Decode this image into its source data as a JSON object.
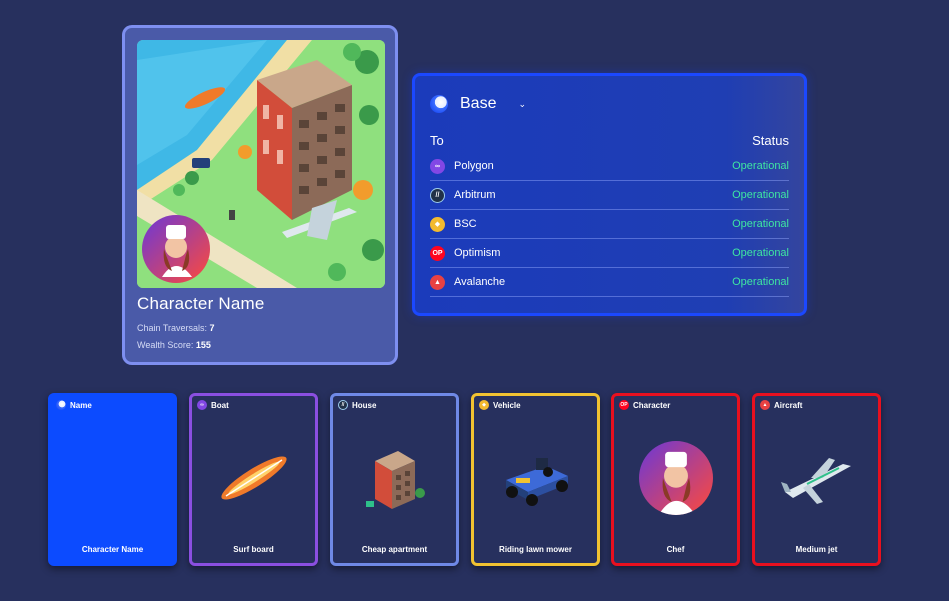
{
  "character": {
    "name": "Character Name",
    "traversals_label": "Chain Traversals:",
    "traversals_value": "7",
    "wealth_label": "Wealth Score:",
    "wealth_value": "155"
  },
  "bridge": {
    "selected_chain": "Base",
    "selected_icon": "base-icon",
    "col_to": "To",
    "col_status": "Status",
    "rows": [
      {
        "name": "Polygon",
        "status": "Operational",
        "icon": "polygon-icon",
        "color": "#8247e5"
      },
      {
        "name": "Arbitrum",
        "status": "Operational",
        "icon": "arbitrum-icon",
        "color": "#213147"
      },
      {
        "name": "BSC",
        "status": "Operational",
        "icon": "bsc-icon",
        "color": "#f3ba2f"
      },
      {
        "name": "Optimism",
        "status": "Operational",
        "icon": "optimism-icon",
        "color": "#ff0420"
      },
      {
        "name": "Avalanche",
        "status": "Operational",
        "icon": "avalanche-icon",
        "color": "#e84142"
      }
    ]
  },
  "assets": [
    {
      "category": "Name",
      "label": "Character Name",
      "icon": "base-icon",
      "border": "#0c4bff"
    },
    {
      "category": "Boat",
      "label": "Surf board",
      "icon": "polygon-icon",
      "border": "#8a4fe0"
    },
    {
      "category": "House",
      "label": "Cheap apartment",
      "icon": "arbitrum-icon",
      "border": "#6f89e6"
    },
    {
      "category": "Vehicle",
      "label": "Riding lawn mower",
      "icon": "bsc-icon",
      "border": "#f1c231"
    },
    {
      "category": "Character",
      "label": "Chef",
      "icon": "optimism-icon",
      "border": "#e8101f"
    },
    {
      "category": "Aircraft",
      "label": "Medium jet",
      "icon": "avalanche-icon",
      "border": "#e8101f"
    }
  ],
  "colors": {
    "background": "#27305e",
    "operational": "#3ee6a2",
    "panel_border": "#1b48ff"
  }
}
